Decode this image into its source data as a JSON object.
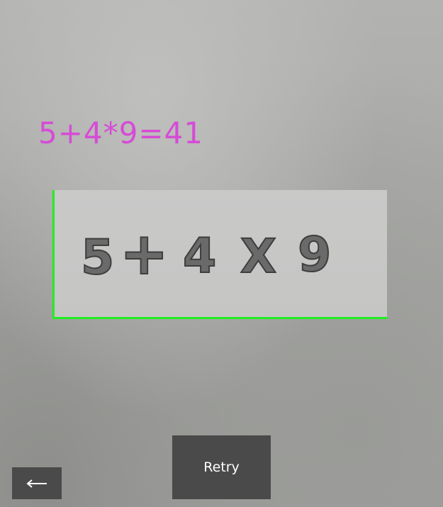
{
  "result": {
    "expression_text": "5+4*9=41"
  },
  "captured_image": {
    "glyphs": [
      "5",
      "+",
      "4",
      "X",
      "9"
    ]
  },
  "buttons": {
    "retry_label": "Retry",
    "back_icon": "arrow-left-icon"
  },
  "colors": {
    "result_text": "#d64bd6",
    "crop_edge": "#22ee22",
    "button_bg": "#4a4a4a",
    "button_text": "#ffffff",
    "glyph_fill": "#6a6a6a",
    "glyph_outline": "#3e3e3e"
  }
}
